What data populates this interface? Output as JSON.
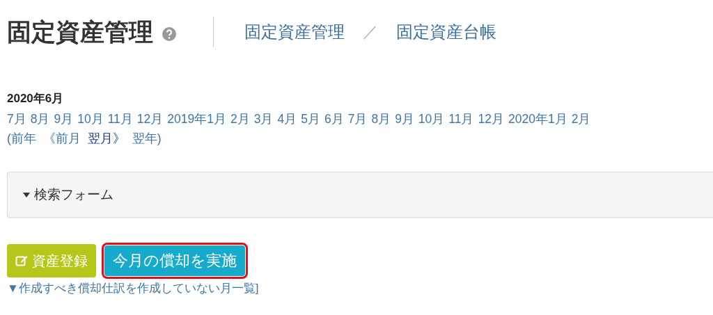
{
  "header": {
    "title": "固定資産管理",
    "breadcrumb": [
      "固定資産管理",
      "固定資産台帳"
    ],
    "separator": "／"
  },
  "period": {
    "current": "2020年6月",
    "months": [
      "7月",
      "8月",
      "9月",
      "10月",
      "11月",
      "12月",
      "2019年1月",
      "2月",
      "3月",
      "4月",
      "5月",
      "6月",
      "7月",
      "8月",
      "9月",
      "10月",
      "11月",
      "12月",
      "2020年1月",
      "2月"
    ],
    "nav": [
      {
        "label": "(前年",
        "visited": false
      },
      {
        "label": "《前月",
        "visited": false
      },
      {
        "label": "翌月》",
        "visited": true
      },
      {
        "label": "翌年)",
        "visited": false
      }
    ]
  },
  "search_panel": {
    "label": "検索フォーム",
    "expanded": false
  },
  "buttons": [
    {
      "label": "資産登録",
      "kind": "register",
      "highlighted": false
    },
    {
      "label": "今月の償却を実施",
      "kind": "depreciate",
      "highlighted": true
    }
  ],
  "footer_link": "▼作成すべき償却仕訳を作成していない月一覧]"
}
